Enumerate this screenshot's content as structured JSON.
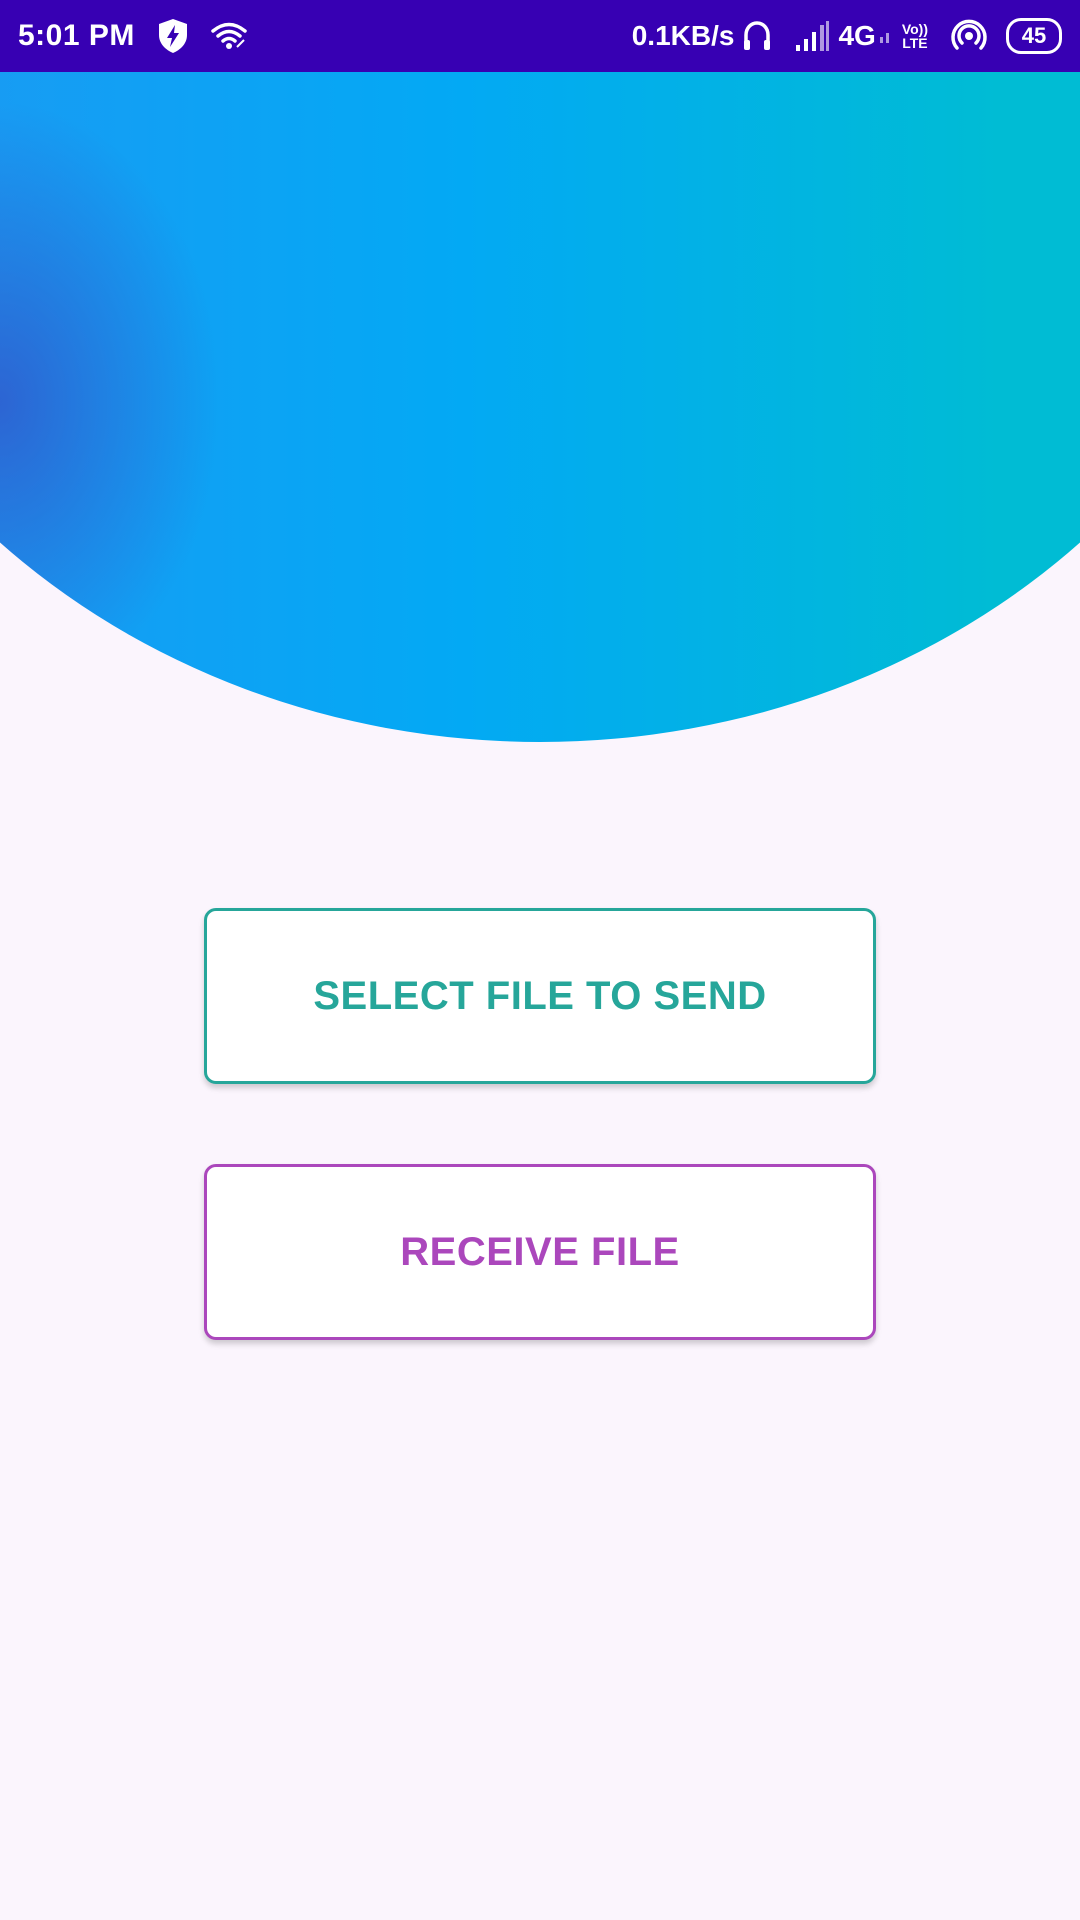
{
  "status_bar": {
    "time": "5:01 PM",
    "network_speed": "0.1KB/s",
    "network_type": "4G",
    "volte_top": "Vo))",
    "volte_bottom": "LTE",
    "battery_level": "45",
    "icons": [
      "shield-bolt-icon",
      "wifi-icon",
      "headphones-icon",
      "signal-icon",
      "hotspot-icon",
      "battery-icon"
    ]
  },
  "colors": {
    "status_bar": "#3700B3",
    "background": "#FBF5FD",
    "send_accent": "#26A69A",
    "receive_accent": "#AB47BC",
    "hero_gradient": [
      "#2196F3",
      "#03A9F4",
      "#00BCD4"
    ]
  },
  "main": {
    "send_button_label": "SELECT FILE TO SEND",
    "receive_button_label": "RECEIVE FILE"
  }
}
